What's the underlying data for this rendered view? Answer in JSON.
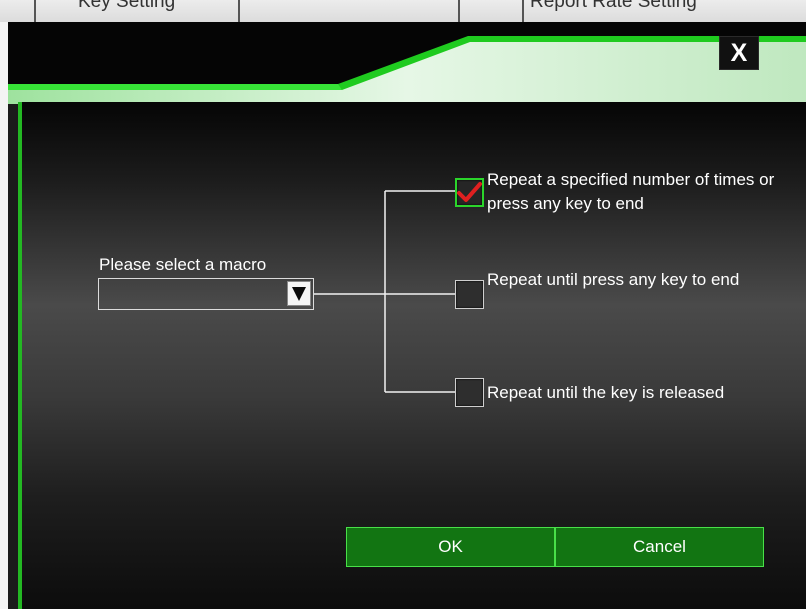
{
  "background_tabs": [
    {
      "label": "Key Setting"
    },
    {
      "label": "Report Rate Setting"
    }
  ],
  "dialog": {
    "close_label": "X",
    "macro_label": "Please select a macro",
    "macro_selected": "",
    "options": [
      {
        "text": "Repeat a specified number of times or press any key to end",
        "checked": true
      },
      {
        "text": "Repeat until press any key to end",
        "checked": false
      },
      {
        "text": "Repeat until the key is released",
        "checked": false
      }
    ],
    "ok_label": "OK",
    "cancel_label": "Cancel"
  },
  "colors": {
    "accent_green": "#23b823",
    "button_green": "#127512",
    "check_red": "#e02020"
  }
}
